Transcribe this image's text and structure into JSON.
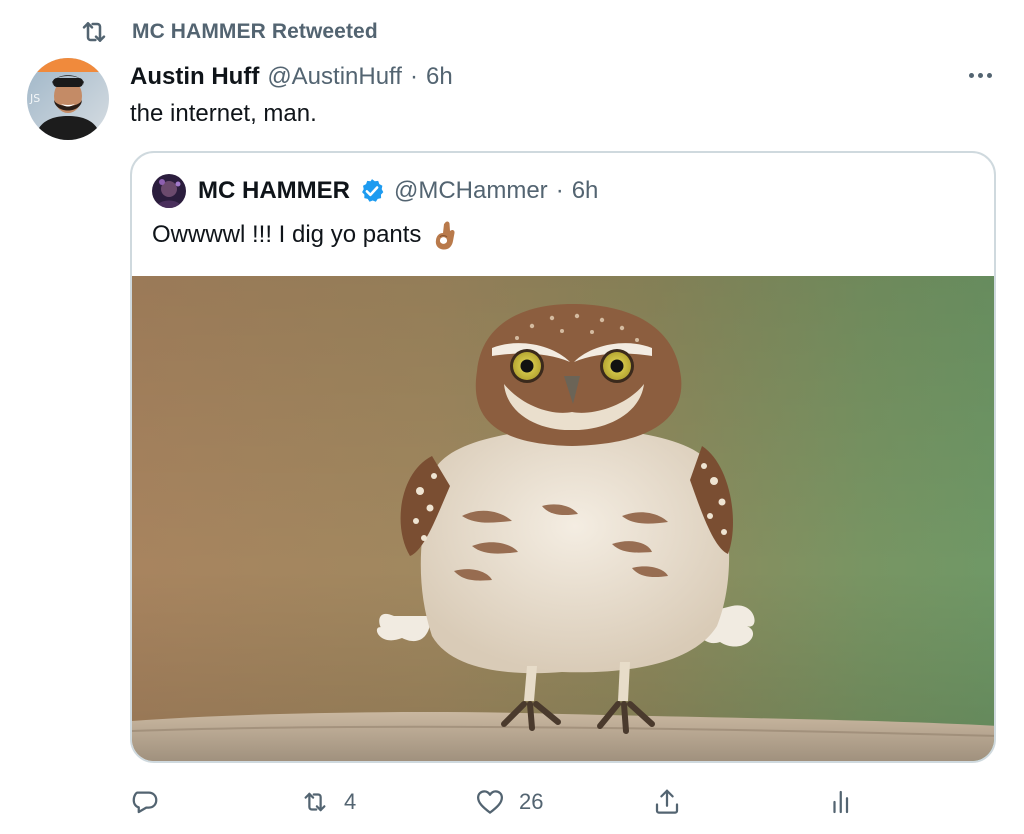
{
  "retweet_header": {
    "text": "MC HAMMER Retweeted",
    "icon": "retweet-icon"
  },
  "tweet": {
    "author_name": "Austin Huff",
    "author_handle": "@AustinHuff",
    "separator": "·",
    "time": "6h",
    "text": "the internet, man.",
    "more_icon": "more-icon"
  },
  "quoted_tweet": {
    "author_name": "MC HAMMER",
    "verified": true,
    "author_handle": "@MCHammer",
    "separator": "·",
    "time": "6h",
    "text": "Owwwwl !!! I dig yo pants",
    "emoji": "ok-hand-emoji",
    "media": "owl photo"
  },
  "actions": {
    "reply": {
      "icon": "reply-icon",
      "count": ""
    },
    "retweet": {
      "icon": "retweet-icon",
      "count": "4"
    },
    "like": {
      "icon": "heart-icon",
      "count": "26"
    },
    "share": {
      "icon": "share-icon"
    },
    "analytics": {
      "icon": "analytics-icon"
    }
  },
  "colors": {
    "text_primary": "#0f1419",
    "text_secondary": "#536471",
    "border": "#cfd9de",
    "verified_blue": "#1d9bf0"
  }
}
